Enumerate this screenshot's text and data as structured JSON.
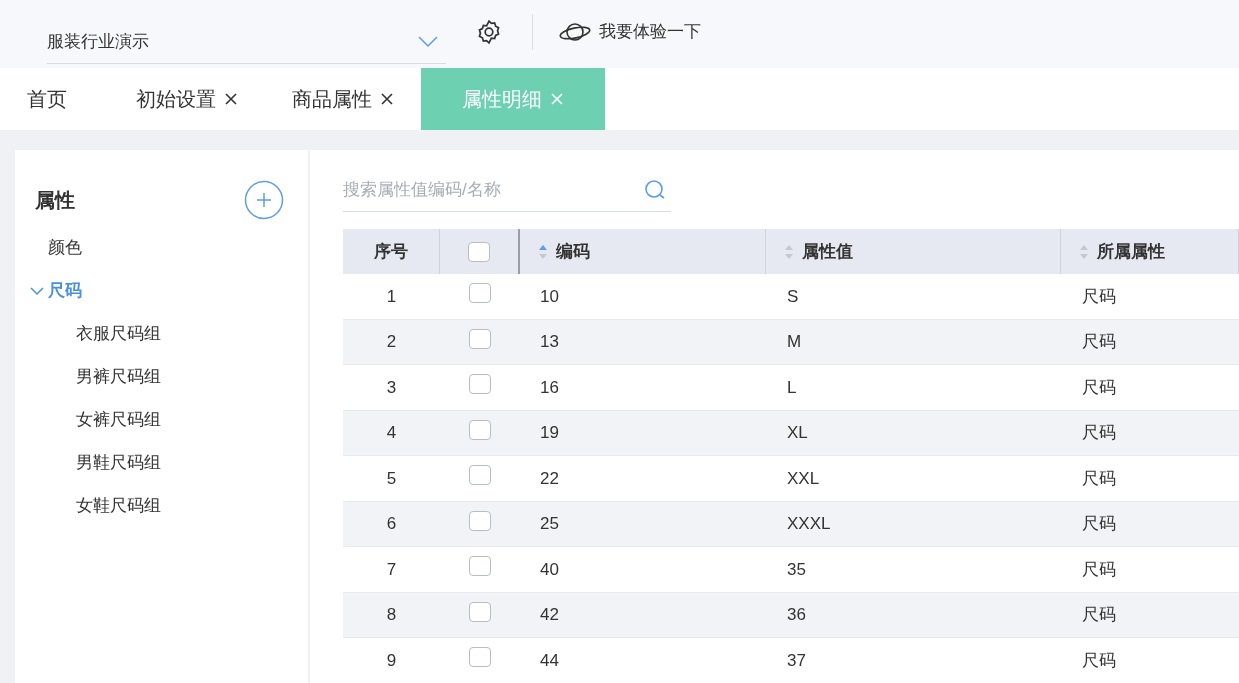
{
  "top_bar": {
    "industry_select": {
      "value": "服装行业演示"
    },
    "try_link": "我要体验一下"
  },
  "tabs": [
    {
      "label": "首页",
      "closable": false,
      "selected": false
    },
    {
      "label": "初始设置",
      "closable": true,
      "selected": false
    },
    {
      "label": "商品属性",
      "closable": true,
      "selected": false
    },
    {
      "label": "属性明细",
      "closable": true,
      "selected": true
    }
  ],
  "sidebar": {
    "title": "属性",
    "items": [
      {
        "label": "颜色",
        "selected": false
      },
      {
        "label": "尺码",
        "selected": true,
        "expanded": true,
        "children": [
          {
            "label": "衣服尺码组",
            "selected": false
          },
          {
            "label": "男裤尺码组",
            "selected": false
          },
          {
            "label": "女裤尺码组",
            "selected": false
          },
          {
            "label": "男鞋尺码组",
            "selected": false
          },
          {
            "label": "女鞋尺码组",
            "selected": false
          }
        ]
      }
    ]
  },
  "search": {
    "placeholder": "搜索属性值编码/名称"
  },
  "table": {
    "columns": [
      {
        "kind": "text",
        "label": "序号"
      },
      {
        "kind": "checkbox",
        "checked": false
      },
      {
        "kind": "sortable",
        "label": "编码",
        "sorted_ascending": true
      },
      {
        "kind": "sortable",
        "label": "属性值",
        "sorted_ascending": false
      },
      {
        "kind": "sortable",
        "label": "所属属性",
        "sorted_ascending": false
      }
    ],
    "rows": [
      {
        "index": "1",
        "checked": false,
        "code": "10",
        "value": "S",
        "attribute": "尺码"
      },
      {
        "index": "2",
        "checked": false,
        "code": "13",
        "value": "M",
        "attribute": "尺码"
      },
      {
        "index": "3",
        "checked": false,
        "code": "16",
        "value": "L",
        "attribute": "尺码"
      },
      {
        "index": "4",
        "checked": false,
        "code": "19",
        "value": "XL",
        "attribute": "尺码"
      },
      {
        "index": "5",
        "checked": false,
        "code": "22",
        "value": "XXL",
        "attribute": "尺码"
      },
      {
        "index": "6",
        "checked": false,
        "code": "25",
        "value": "XXXL",
        "attribute": "尺码"
      },
      {
        "index": "7",
        "checked": false,
        "code": "40",
        "value": "35",
        "attribute": "尺码"
      },
      {
        "index": "8",
        "checked": false,
        "code": "42",
        "value": "36",
        "attribute": "尺码"
      },
      {
        "index": "9",
        "checked": false,
        "code": "44",
        "value": "37",
        "attribute": "尺码"
      }
    ]
  }
}
